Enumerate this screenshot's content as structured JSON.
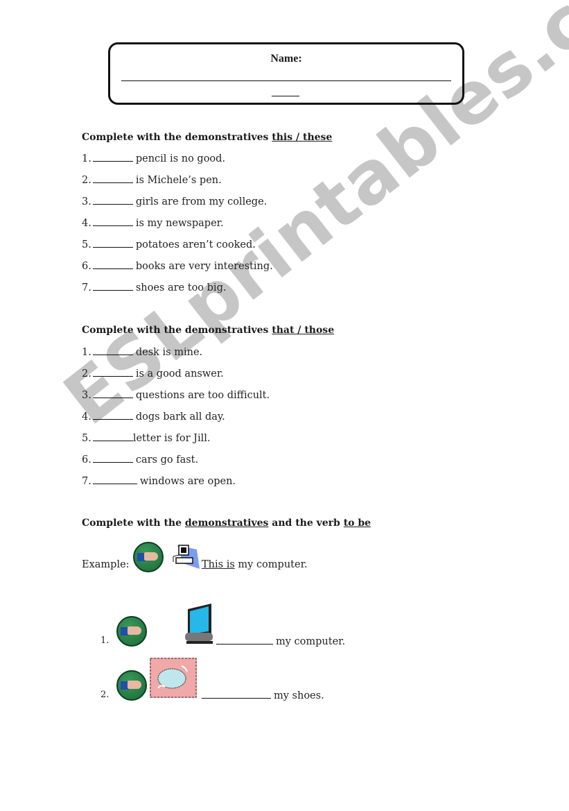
{
  "header": {
    "name_label": "Name:"
  },
  "section1": {
    "title_prefix": "Complete with the demonstratives ",
    "title_emph": "this / these",
    "items": [
      {
        "num": "1.",
        "text": "pencil is no good."
      },
      {
        "num": "2.",
        "text": "is Michele’s pen."
      },
      {
        "num": "3.",
        "text": "girls are from my college."
      },
      {
        "num": "4.",
        "text": "is my newspaper."
      },
      {
        "num": "5.",
        "text": "potatoes aren’t cooked."
      },
      {
        "num": "6.",
        "text": "books are very interesting."
      },
      {
        "num": "7.",
        "text": "shoes are too big."
      }
    ]
  },
  "section2": {
    "title_prefix": "Complete with the demonstratives ",
    "title_emph": "that / those",
    "items": [
      {
        "num": "1.",
        "text": "desk is mine."
      },
      {
        "num": "2.",
        "text": "is a good answer."
      },
      {
        "num": "3.",
        "text": "questions are too difficult."
      },
      {
        "num": "4.",
        "text": "dogs bark all day."
      },
      {
        "num": "5.",
        "text": "letter is for Jill."
      },
      {
        "num": "6.",
        "text": "cars go fast."
      },
      {
        "num": "7.",
        "text": "windows are open."
      }
    ]
  },
  "section3": {
    "title_a": "Complete with the ",
    "title_b": "demonstratives",
    "title_c": " and the verb ",
    "title_d": "to be",
    "example_label": "Example:",
    "example_answer": "This is",
    "example_rest": " my computer.",
    "items": [
      {
        "num": "1.",
        "text": "my computer.",
        "icons": [
          "pointing-hand-icon",
          "computer-monitor-icon"
        ]
      },
      {
        "num": "2.",
        "text": "my shoes.",
        "icons": [
          "pointing-hand-icon",
          "shoes-icon"
        ]
      }
    ]
  },
  "watermark": "ESLprintables.com"
}
